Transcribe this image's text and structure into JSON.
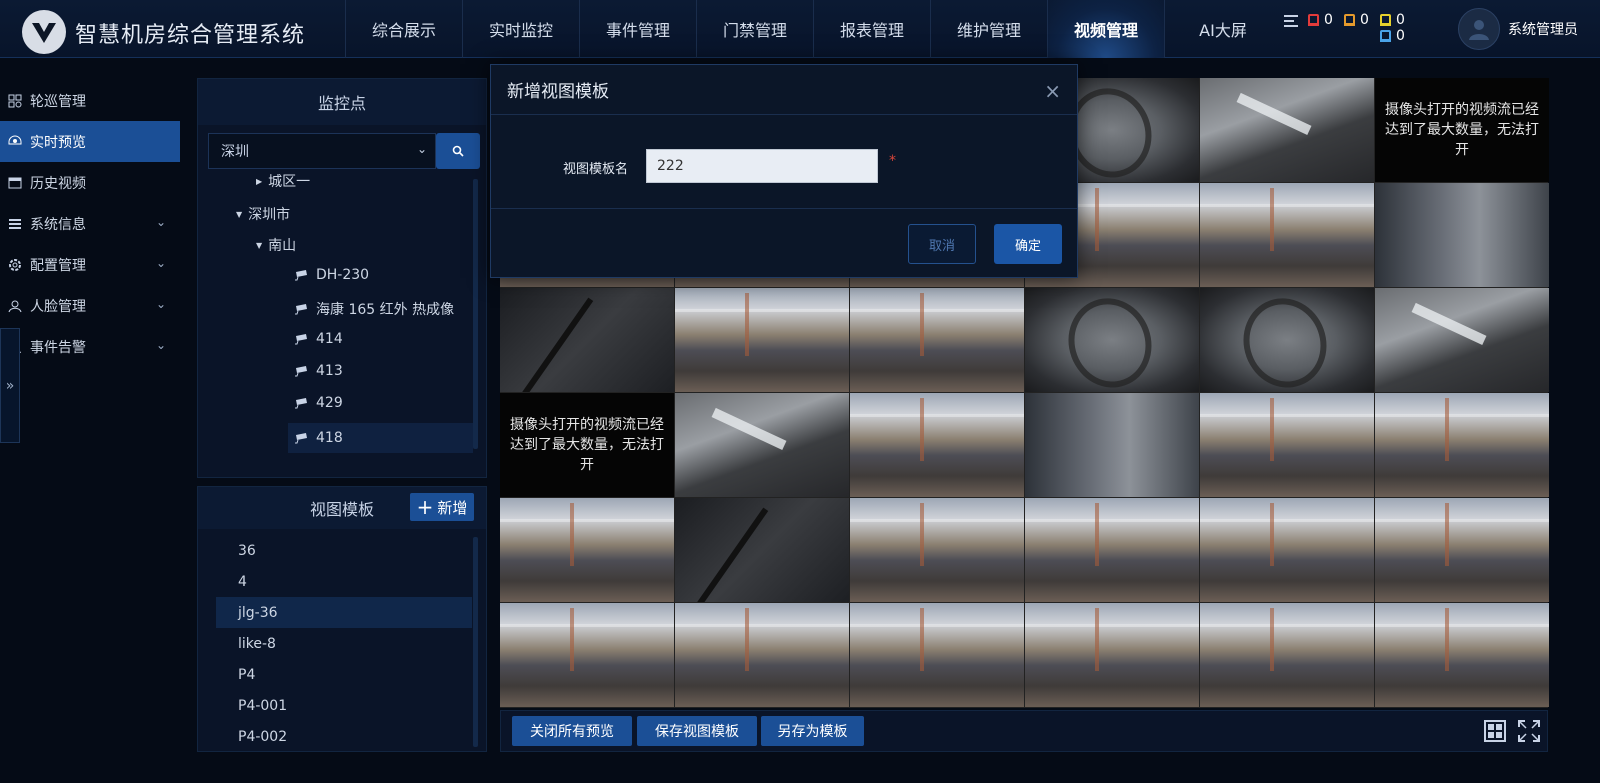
{
  "header": {
    "app_title": "智慧机房综合管理系统",
    "nav": [
      "综合展示",
      "实时监控",
      "事件管理",
      "门禁管理",
      "报表管理",
      "维护管理",
      "视频管理",
      "AI大屏"
    ],
    "active_nav": "视频管理",
    "alerts": [
      {
        "color": "#e23b3b",
        "count": "0"
      },
      {
        "color": "#e59a2c",
        "count": "0"
      },
      {
        "color": "#e5d02c",
        "count": "0"
      },
      {
        "color": "#4aa3e8",
        "count": "0"
      }
    ],
    "user_name": "系统管理员"
  },
  "sidebar": {
    "items": [
      {
        "label": "轮巡管理",
        "icon": "patrol-icon",
        "has_children": false
      },
      {
        "label": "实时预览",
        "icon": "camera-icon",
        "has_children": false,
        "active": true
      },
      {
        "label": "历史视频",
        "icon": "history-icon",
        "has_children": false
      },
      {
        "label": "系统信息",
        "icon": "list-icon",
        "has_children": true
      },
      {
        "label": "配置管理",
        "icon": "gear-icon",
        "has_children": true
      },
      {
        "label": "人脸管理",
        "icon": "users-icon",
        "has_children": true
      },
      {
        "label": "事件告警",
        "icon": "warning-icon",
        "has_children": true
      }
    ],
    "expand_glyph": "»"
  },
  "monitor_panel": {
    "title": "监控点",
    "region_select": "深圳",
    "tree": {
      "partial_node": "城区一",
      "city": "深圳市",
      "district": "南山",
      "cameras": [
        "DH-230",
        "海康 165 红外 热成像",
        "414",
        "413",
        "429",
        "418"
      ]
    }
  },
  "template_panel": {
    "title": "视图模板",
    "add_label": "新增",
    "items": [
      "36",
      "4",
      "jlg-36",
      "like-8",
      "P4",
      "P4-001",
      "P4-002"
    ],
    "selected": "jlg-36"
  },
  "video_grid": {
    "error_message": "摄像头打开的视频流已经达到了最大数量，无法打开"
  },
  "bottom_bar": {
    "close_all": "关闭所有预览",
    "save_template": "保存视图模板",
    "save_as": "另存为模板"
  },
  "modal": {
    "title": "新增视图模板",
    "field_label": "视图模板名",
    "field_value": "222",
    "required_mark": "*",
    "cancel": "取消",
    "confirm": "确定",
    "close_glyph": "×"
  }
}
